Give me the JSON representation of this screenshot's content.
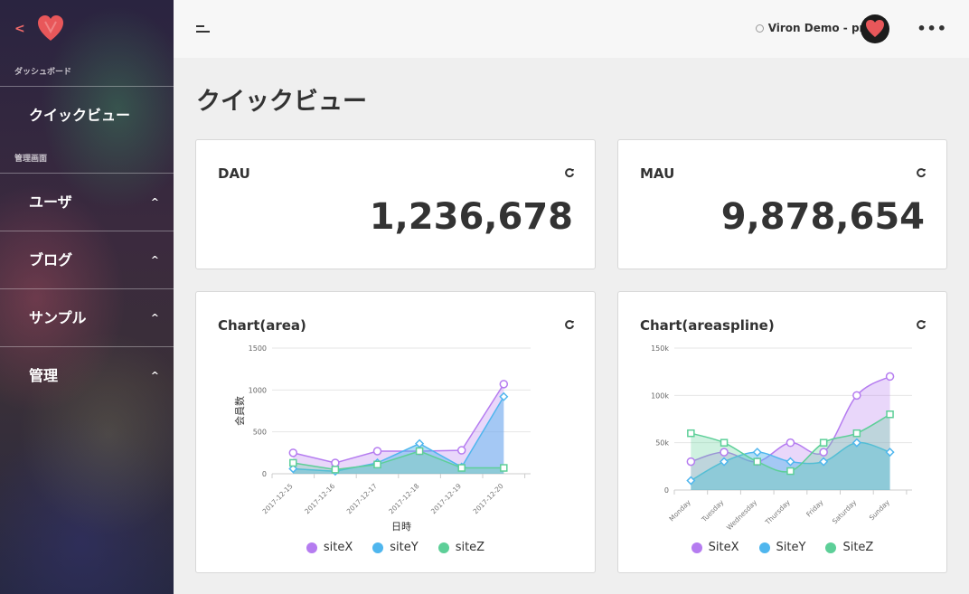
{
  "sidebar": {
    "sections": [
      {
        "title": "ダッシュボード",
        "items": [
          {
            "label": "クイックビュー"
          }
        ]
      },
      {
        "title": "管理画面",
        "items": [
          {
            "label": "ユーザ"
          },
          {
            "label": "ブログ"
          },
          {
            "label": "サンプル"
          },
          {
            "label": "管理"
          }
        ]
      }
    ]
  },
  "topbar": {
    "env": "Viron Demo - prd",
    "more": "•••"
  },
  "page": {
    "title": "クイックビュー"
  },
  "cards": {
    "dau": {
      "title": "DAU",
      "value": "1,236,678"
    },
    "mau": {
      "title": "MAU",
      "value": "9,878,654"
    },
    "area": {
      "title": "Chart(area)"
    },
    "areaspline": {
      "title": "Chart(areaspline)"
    }
  },
  "colors": {
    "siteX": "#b57cf0",
    "siteY": "#4fb6ee",
    "siteZ": "#5dcf98",
    "logo": "#e8575a"
  },
  "chart_data": [
    {
      "type": "area",
      "categories": [
        "2017-12-15",
        "2017-12-16",
        "2017-12-17",
        "2017-12-18",
        "2017-12-19",
        "2017-12-20"
      ],
      "series": [
        {
          "name": "siteX",
          "values": [
            250,
            130,
            270,
            270,
            280,
            1070
          ]
        },
        {
          "name": "siteY",
          "values": [
            60,
            30,
            130,
            360,
            80,
            920
          ]
        },
        {
          "name": "siteZ",
          "values": [
            130,
            50,
            110,
            270,
            70,
            70
          ]
        }
      ],
      "yticks": [
        "0",
        "500",
        "1000",
        "1500"
      ],
      "ylim": [
        0,
        1500
      ],
      "xlabel": "日時",
      "ylabel": "会員数",
      "legend": "bottom"
    },
    {
      "type": "area",
      "categories": [
        "Monday",
        "Tuesday",
        "Wednesday",
        "Thursday",
        "Friday",
        "Saturday",
        "Sunday"
      ],
      "series": [
        {
          "name": "SiteX",
          "values": [
            30000,
            40000,
            30000,
            50000,
            40000,
            100000,
            120000
          ]
        },
        {
          "name": "SiteY",
          "values": [
            10000,
            30000,
            40000,
            30000,
            30000,
            50000,
            40000
          ]
        },
        {
          "name": "SiteZ",
          "values": [
            60000,
            50000,
            30000,
            20000,
            50000,
            60000,
            80000
          ]
        }
      ],
      "yticks": [
        "0",
        "50k",
        "100k",
        "150k"
      ],
      "ylim": [
        0,
        150000
      ],
      "legend": "bottom"
    }
  ]
}
